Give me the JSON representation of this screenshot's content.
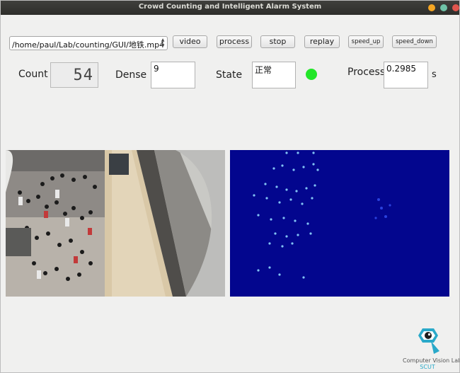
{
  "window": {
    "title": "Crowd Counting and Intelligent Alarm System"
  },
  "toolbar": {
    "file_path": "/home/paul/Lab/counting/GUI/地铁.mp4",
    "video_label": "video",
    "process_label": "process",
    "stop_label": "stop",
    "replay_label": "replay",
    "speed_up_label": "speed_up",
    "speed_down_label": "speed_down"
  },
  "status": {
    "count_label": "Count",
    "count_value": "54",
    "dense_label": "Dense",
    "dense_value": "9",
    "state_label": "State",
    "state_value": "正常",
    "state_color": "#22e628",
    "process_label": "Process",
    "process_value": "0.2985",
    "process_unit": "s"
  },
  "panels": {
    "camera_icon": "camera-frame",
    "density_background": "#03068e"
  },
  "logo": {
    "line1": "Computer Vision Lab",
    "line2": "SCUT"
  }
}
